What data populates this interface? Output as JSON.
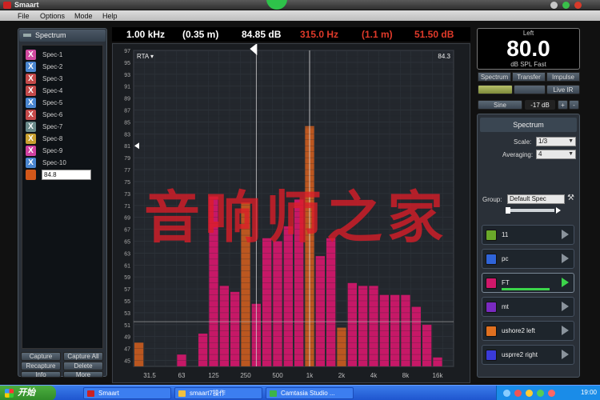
{
  "window": {
    "title": "Smaart"
  },
  "menu": [
    "File",
    "Options",
    "Mode",
    "Help"
  ],
  "left_panel": {
    "title": "Spectrum",
    "specs": [
      {
        "name": "Spec-1",
        "color": "#d04aa0"
      },
      {
        "name": "Spec-2",
        "color": "#4a86d0"
      },
      {
        "name": "Spec-3",
        "color": "#c44a4a"
      },
      {
        "name": "Spec-4",
        "color": "#c44a4a"
      },
      {
        "name": "Spec-5",
        "color": "#4a86d0"
      },
      {
        "name": "Spec-6",
        "color": "#c44a4a"
      },
      {
        "name": "Spec-7",
        "color": "#6a8a8a"
      },
      {
        "name": "Spec-8",
        "color": "#c8a030"
      },
      {
        "name": "Spec-9",
        "color": "#d040a0"
      },
      {
        "name": "Spec-10",
        "color": "#4a86d0"
      }
    ],
    "new_spec_value": "84.8",
    "buttons": {
      "capture": "Capture",
      "capture_all": "Capture All",
      "recapture": "Recapture",
      "delete": "Delete",
      "info": "Info",
      "more": "More"
    }
  },
  "readout": {
    "freq": "1.00 kHz",
    "dist": "(0.35 m)",
    "level": "84.85 dB",
    "freq2": "315.0 Hz",
    "dist2": "(1.1 m)",
    "level2": "51.50 dB",
    "white_color": "#ffffff",
    "red_color": "#e03a2a"
  },
  "plot": {
    "mode_label": "RTA ▾",
    "peak_label": "84.3"
  },
  "chart_data": {
    "type": "bar",
    "ylim": [
      44,
      97
    ],
    "y_ticks": [
      45,
      47,
      49,
      51,
      53,
      55,
      57,
      59,
      61,
      63,
      65,
      67,
      69,
      71,
      73,
      75,
      77,
      79,
      81,
      83,
      85,
      87,
      89,
      91,
      93,
      95,
      97
    ],
    "x_tick_labels": [
      "31.5",
      "63",
      "125",
      "250",
      "500",
      "1k",
      "2k",
      "4k",
      "8k",
      "16k"
    ],
    "bands": [
      "25",
      "31.5",
      "40",
      "50",
      "63",
      "80",
      "100",
      "125",
      "160",
      "200",
      "250",
      "315",
      "400",
      "500",
      "630",
      "800",
      "1k",
      "1.25k",
      "1.6k",
      "2k",
      "2.5k",
      "3.15k",
      "4k",
      "5k",
      "6.3k",
      "8k",
      "10k",
      "12.5k",
      "16k",
      "20k"
    ],
    "values": [
      48,
      44,
      44,
      44,
      46,
      44,
      49.5,
      72.5,
      57.5,
      56.5,
      71.5,
      54.5,
      65.5,
      65,
      67.5,
      72,
      84.3,
      62.5,
      65.5,
      50.5,
      58,
      57.5,
      57.5,
      56,
      56,
      56,
      54,
      51,
      45.5,
      44
    ],
    "series_color": "#d0176a",
    "highlight_bands": [
      0,
      10,
      16,
      19
    ],
    "highlight_color": "#c45a20",
    "cursor_bands": [
      11,
      16
    ],
    "threshold": 51.5
  },
  "meter": {
    "label": "Left",
    "value": "80.0",
    "sub": "dB SPL Fast"
  },
  "right_tabs": {
    "spectrum": "Spectrum",
    "transfer": "Transfer",
    "impulse": "Impulse",
    "live_ir": "Live IR",
    "sine": "Sine",
    "gain": "-17 dB",
    "plus": "+",
    "minus": "-"
  },
  "right_panel": {
    "title": "Spectrum",
    "scale_label": "Scale:",
    "scale_value": "1/3",
    "averaging_label": "Averaging:",
    "averaging_value": "4",
    "group_label": "Group:",
    "group_value": "Default Spec",
    "traces": [
      {
        "name": "11",
        "color": "#6aa82a"
      },
      {
        "name": "pc",
        "color": "#2f64d8"
      },
      {
        "name": "FT",
        "color": "#d0176a",
        "active": true
      },
      {
        "name": "mt",
        "color": "#7a2ac0"
      },
      {
        "name": "ushore2 left",
        "color": "#e07020"
      },
      {
        "name": "usprre2 right",
        "color": "#3a3ad8"
      }
    ]
  },
  "watermark": "音响师之家",
  "taskbar": {
    "start": "开始",
    "tasks": [
      "Smaart",
      "smaart7操作",
      "Camtasia Studio ..."
    ],
    "clock": "19:00"
  }
}
